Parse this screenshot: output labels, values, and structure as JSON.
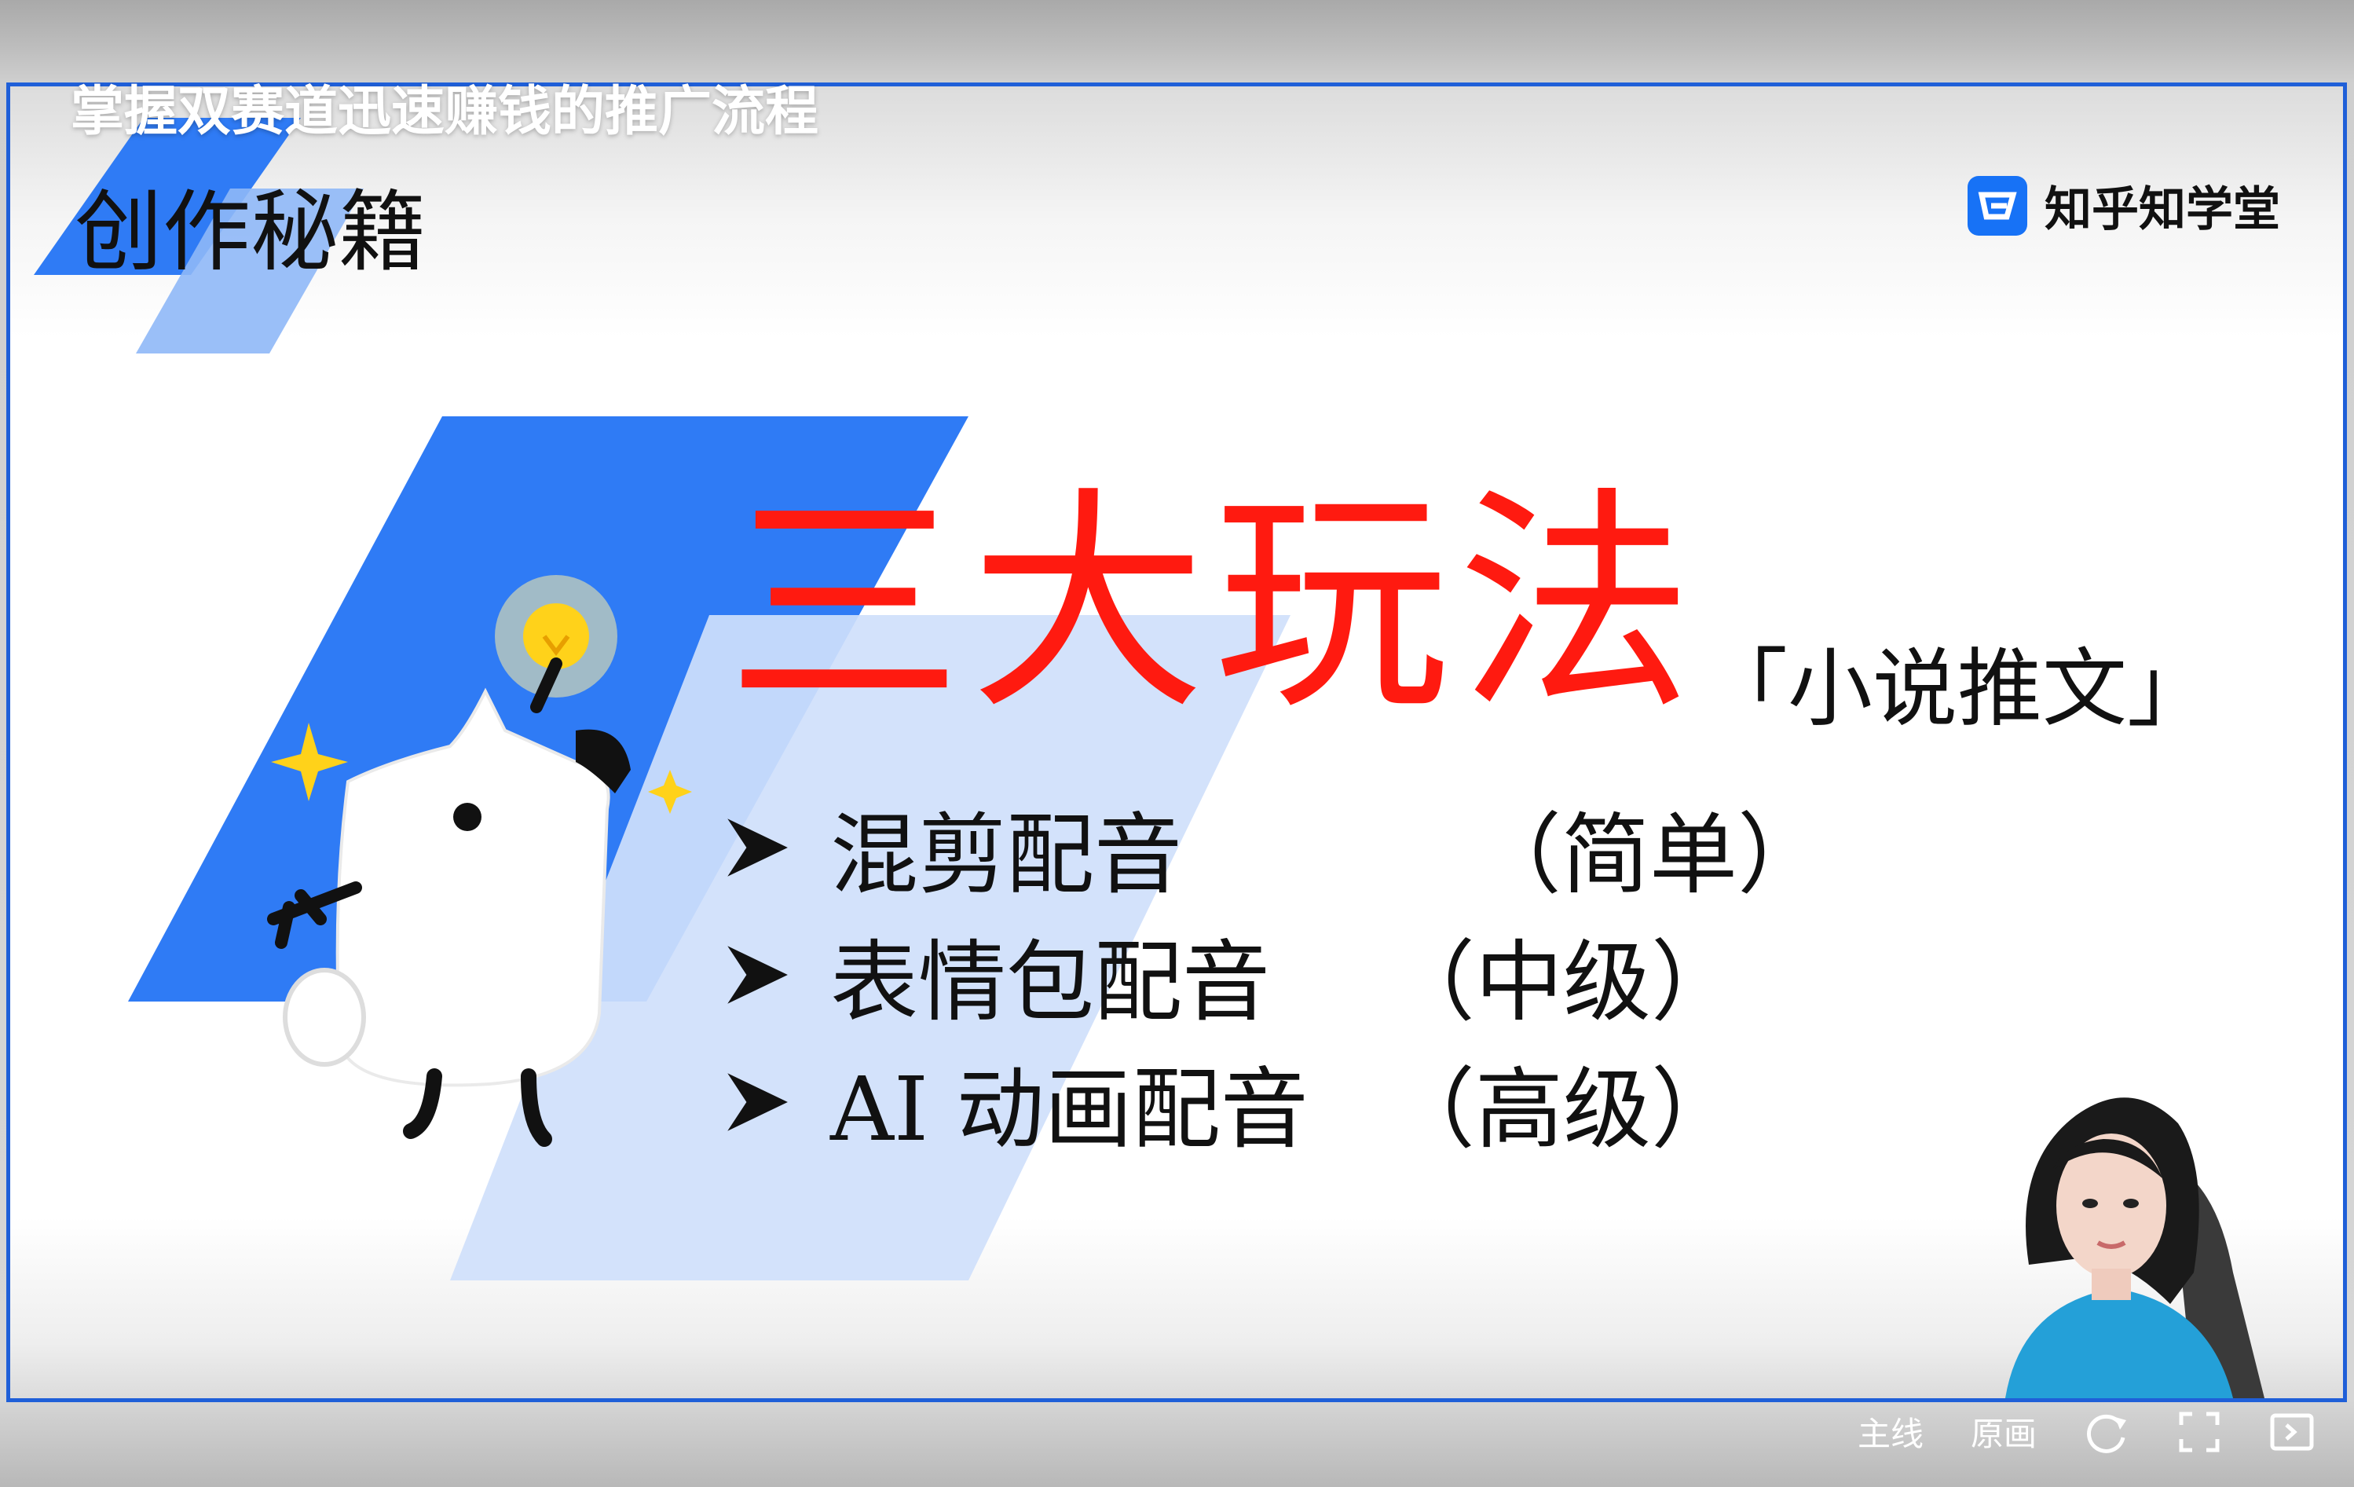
{
  "video_title": "掌握双赛道迅速赚钱的推广流程",
  "slide": {
    "section_title": "创作秘籍",
    "brand": {
      "name": "知乎知学堂",
      "icon": "zhihu-logo-icon"
    },
    "main_title": "三大玩法",
    "subtitle": "「小说推文」",
    "items": [
      {
        "label": "混剪配音",
        "level": "（简单）"
      },
      {
        "label": "表情包配音",
        "level": "（中级）"
      },
      {
        "label": "AI 动画配音",
        "level": "（高级）"
      }
    ],
    "illustration": "white-dog-mascot-with-lightbulb"
  },
  "controls": {
    "line_label": "主线",
    "quality_label": "原画",
    "icons": [
      "refresh-icon",
      "fullscreen-icon",
      "picture-in-picture-icon"
    ]
  },
  "colors": {
    "accent_blue": "#2f7bf5",
    "light_blue": "#cfe0fb",
    "title_red": "#ff1a10",
    "frame_border": "#1f5fd8"
  }
}
